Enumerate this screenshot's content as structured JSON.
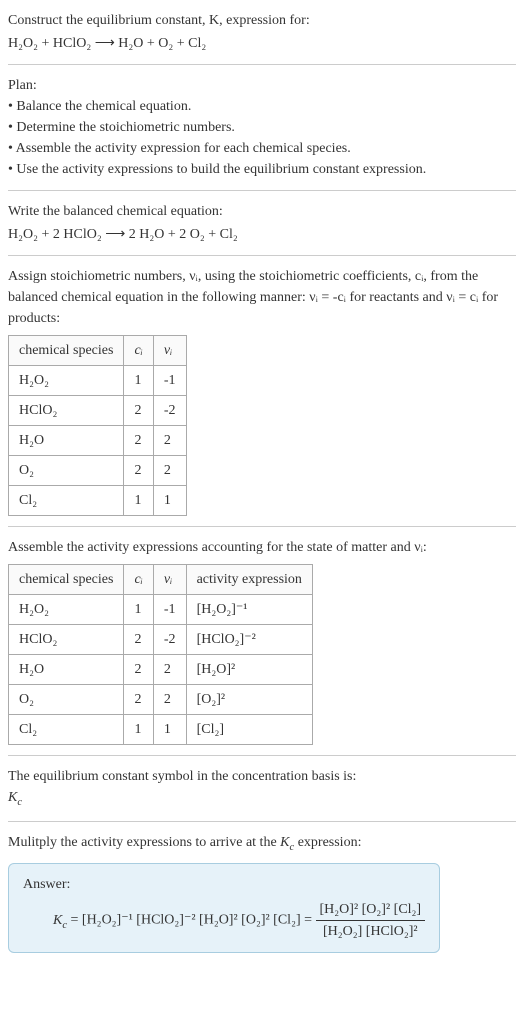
{
  "intro": {
    "line1": "Construct the equilibrium constant, K, expression for:",
    "eq": "H₂O₂ + HClO₂  ⟶  H₂O + O₂ + Cl₂"
  },
  "plan": {
    "heading": "Plan:",
    "items": [
      "Balance the chemical equation.",
      "Determine the stoichiometric numbers.",
      "Assemble the activity expression for each chemical species.",
      "Use the activity expressions to build the equilibrium constant expression."
    ]
  },
  "balanced": {
    "heading": "Write the balanced chemical equation:",
    "eq": "H₂O₂ + 2 HClO₂  ⟶  2 H₂O + 2 O₂ + Cl₂"
  },
  "assign": {
    "text": "Assign stoichiometric numbers, νᵢ, using the stoichiometric coefficients, cᵢ, from the balanced chemical equation in the following manner: νᵢ = -cᵢ for reactants and νᵢ = cᵢ for products:",
    "headers": [
      "chemical species",
      "cᵢ",
      "νᵢ"
    ],
    "rows": [
      [
        "H₂O₂",
        "1",
        "-1"
      ],
      [
        "HClO₂",
        "2",
        "-2"
      ],
      [
        "H₂O",
        "2",
        "2"
      ],
      [
        "O₂",
        "2",
        "2"
      ],
      [
        "Cl₂",
        "1",
        "1"
      ]
    ]
  },
  "activity": {
    "text": "Assemble the activity expressions accounting for the state of matter and νᵢ:",
    "headers": [
      "chemical species",
      "cᵢ",
      "νᵢ",
      "activity expression"
    ],
    "rows": [
      [
        "H₂O₂",
        "1",
        "-1",
        "[H₂O₂]⁻¹"
      ],
      [
        "HClO₂",
        "2",
        "-2",
        "[HClO₂]⁻²"
      ],
      [
        "H₂O",
        "2",
        "2",
        "[H₂O]²"
      ],
      [
        "O₂",
        "2",
        "2",
        "[O₂]²"
      ],
      [
        "Cl₂",
        "1",
        "1",
        "[Cl₂]"
      ]
    ]
  },
  "symbol": {
    "line1": "The equilibrium constant symbol in the concentration basis is:",
    "line2": "K_c"
  },
  "multiply": {
    "text": "Mulitply the activity expressions to arrive at the K_c expression:"
  },
  "answer": {
    "label": "Answer:",
    "lhs": "K_c = [H₂O₂]⁻¹ [HClO₂]⁻² [H₂O]² [O₂]² [Cl₂] = ",
    "num": "[H₂O]² [O₂]² [Cl₂]",
    "den": "[H₂O₂] [HClO₂]²"
  },
  "chart_data": {
    "type": "table",
    "tables": [
      {
        "title": "Stoichiometric numbers",
        "columns": [
          "chemical species",
          "c_i",
          "nu_i"
        ],
        "rows": [
          [
            "H2O2",
            1,
            -1
          ],
          [
            "HClO2",
            2,
            -2
          ],
          [
            "H2O",
            2,
            2
          ],
          [
            "O2",
            2,
            2
          ],
          [
            "Cl2",
            1,
            1
          ]
        ]
      },
      {
        "title": "Activity expressions",
        "columns": [
          "chemical species",
          "c_i",
          "nu_i",
          "activity expression"
        ],
        "rows": [
          [
            "H2O2",
            1,
            -1,
            "[H2O2]^-1"
          ],
          [
            "HClO2",
            2,
            -2,
            "[HClO2]^-2"
          ],
          [
            "H2O",
            2,
            2,
            "[H2O]^2"
          ],
          [
            "O2",
            2,
            2,
            "[O2]^2"
          ],
          [
            "Cl2",
            1,
            1,
            "[Cl2]"
          ]
        ]
      }
    ]
  }
}
